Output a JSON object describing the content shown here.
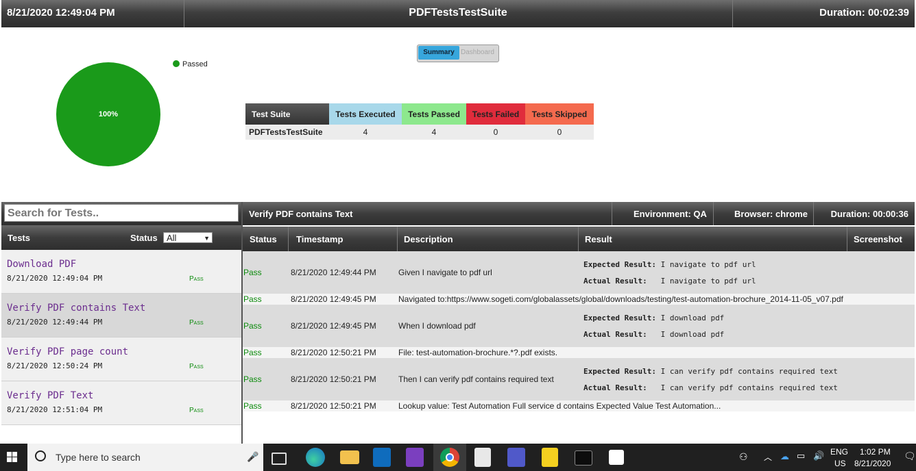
{
  "header": {
    "timestamp": "8/21/2020 12:49:04 PM",
    "suite_title": "PDFTestsTestSuite",
    "duration": "Duration: 00:02:39"
  },
  "pie": {
    "label": "100%",
    "legend": "Passed",
    "passed_fraction": 1.0,
    "color": "#1a9a1a"
  },
  "view_toggle": {
    "summary": "Summary",
    "dashboard": "Dashboard"
  },
  "summary_table": {
    "headers": [
      "Test Suite",
      "Tests Executed",
      "Tests Passed",
      "Tests Failed",
      "Tests Skipped"
    ],
    "header_colors": [
      "#4a4a4a",
      "#a8d8ea",
      "#8de88d",
      "#e02c3c",
      "#f46a4e"
    ],
    "row": [
      "PDFTestsTestSuite",
      "4",
      "4",
      "0",
      "0"
    ]
  },
  "tests_panel": {
    "search_placeholder": "Search for Tests..",
    "col_tests": "Tests",
    "col_status": "Status",
    "status_filter": "All",
    "items": [
      {
        "name": "Download PDF",
        "time": "8/21/2020 12:49:04 PM",
        "status": "Pass"
      },
      {
        "name": "Verify PDF contains Text",
        "time": "8/21/2020 12:49:44 PM",
        "status": "Pass"
      },
      {
        "name": "Verify PDF page count",
        "time": "8/21/2020 12:50:24 PM",
        "status": "Pass"
      },
      {
        "name": "Verify PDF Text",
        "time": "8/21/2020 12:51:04 PM",
        "status": "Pass"
      }
    ]
  },
  "detail": {
    "title": "Verify PDF contains Text",
    "environment": "Environment: QA",
    "browser": "Browser: chrome",
    "duration": "Duration: 00:00:36",
    "columns": [
      "Status",
      "Timestamp",
      "Description",
      "Result",
      "Screenshot"
    ],
    "steps": [
      {
        "status": "Pass",
        "time": "8/21/2020 12:49:44 PM",
        "desc": "Given I navigate to pdf url",
        "expected": "I navigate to pdf url",
        "actual": "I navigate to pdf url"
      },
      {
        "status": "Pass",
        "time": "8/21/2020 12:49:45 PM",
        "desc": "Navigated to:https://www.sogeti.com/globalassets/global/downloads/testing/test-automation-brochure_2014-11-05_v07.pdf"
      },
      {
        "status": "Pass",
        "time": "8/21/2020 12:49:45 PM",
        "desc": "When I download pdf",
        "expected": "I download pdf",
        "actual": "I download pdf"
      },
      {
        "status": "Pass",
        "time": "8/21/2020 12:50:21 PM",
        "desc": "File: test-automation-brochure.*?.pdf exists."
      },
      {
        "status": "Pass",
        "time": "8/21/2020 12:50:21 PM",
        "desc": "Then I can verify pdf contains required text",
        "expected": "I can verify pdf contains required text",
        "actual": "I can verify pdf contains required text"
      },
      {
        "status": "Pass",
        "time": "8/21/2020 12:50:21 PM",
        "desc": "Lookup value: Test Automation Full service d contains Expected Value Test Automation..."
      }
    ],
    "expected_label": "Expected Result:",
    "actual_label": "Actual Result:"
  },
  "taskbar": {
    "search_placeholder": "Type here to search",
    "lang": "ENG",
    "region": "US",
    "time": "1:02 PM",
    "date": "8/21/2020"
  }
}
